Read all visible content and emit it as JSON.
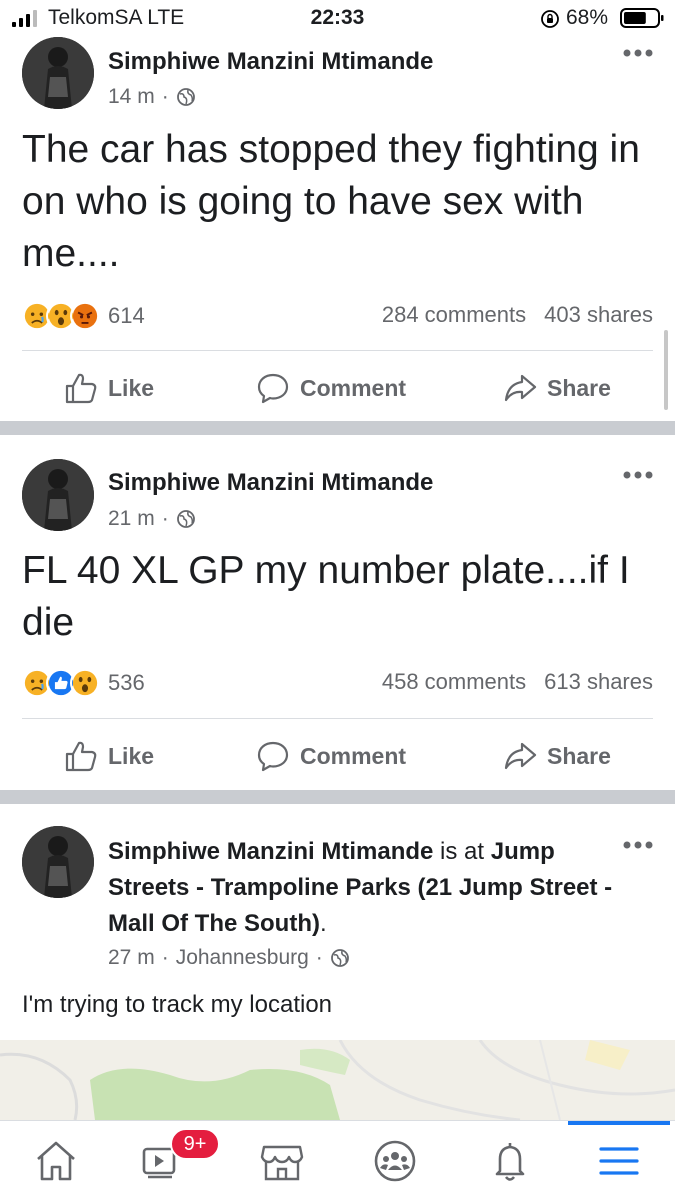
{
  "status_bar": {
    "carrier": "TelkomSA  LTE",
    "time": "22:33",
    "battery_percent": "68%",
    "battery_level": 0.68,
    "signal_icon": "signal-bars-icon",
    "lock_icon": "rotation-lock-icon"
  },
  "posts": [
    {
      "author": "Simphiwe Manzini Mtimande",
      "time": "14 m",
      "separator": "·",
      "text": "The car has stopped they fighting in on who is going to have sex with me....",
      "reactions": [
        "sad",
        "wow",
        "angry"
      ],
      "reaction_count": "614",
      "comments": "284 comments",
      "shares": "403 shares"
    },
    {
      "author": "Simphiwe Manzini Mtimande",
      "time": "21 m",
      "separator": "·",
      "text": "FL 40 XL GP my number plate....if I die",
      "reactions": [
        "sad",
        "like",
        "wow"
      ],
      "reaction_count": "536",
      "comments": "458 comments",
      "shares": "613 shares"
    },
    {
      "author": "Simphiwe Manzini Mtimande",
      "is_at": "is at",
      "place": "Jump Streets - Trampoline Parks (21 Jump Street - Mall Of The South)",
      "period": ".",
      "time": "27 m",
      "location": "Johannesburg",
      "separator": "·",
      "text": "I'm trying to track my location"
    }
  ],
  "actions": {
    "like": "Like",
    "comment": "Comment",
    "share": "Share"
  },
  "bottom_nav": {
    "items": [
      "home-icon",
      "watch-icon",
      "marketplace-icon",
      "groups-icon",
      "notifications-icon",
      "menu-icon"
    ],
    "watch_badge": "9+",
    "active": "menu-icon"
  },
  "colors": {
    "accent": "#1877f2",
    "badge": "#e41e3f",
    "secondary_text": "#65676b",
    "separator": "#c9ccd1",
    "sad_reaction": "#f7b125",
    "angry_reaction": "#e9710f",
    "like_reaction": "#1877f2"
  }
}
